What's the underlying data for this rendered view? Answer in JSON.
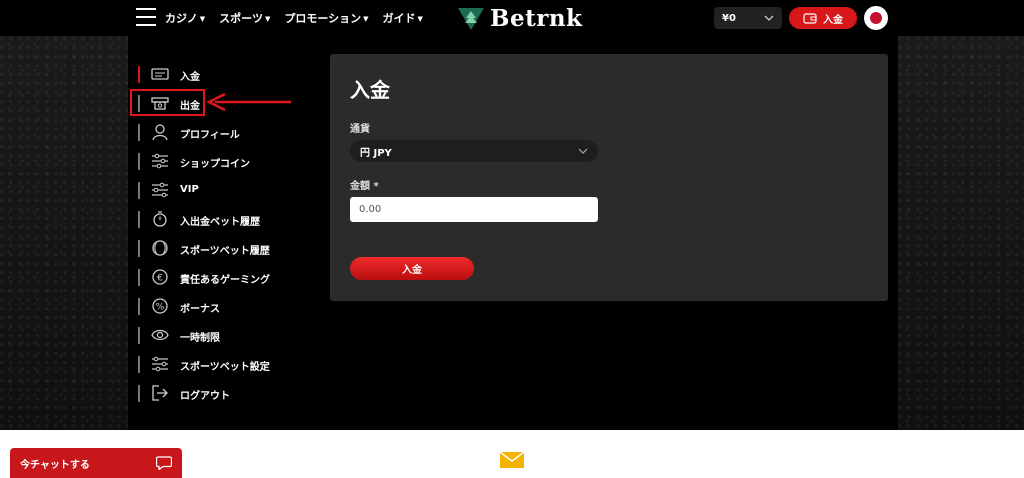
{
  "header": {
    "nav": [
      {
        "label": "カジノ"
      },
      {
        "label": "スポーツ"
      },
      {
        "label": "プロモーション"
      },
      {
        "label": "ガイド"
      }
    ],
    "logo_text": "Betrnk",
    "balance": "¥0",
    "deposit_button": "入金",
    "language_flag": "japan-flag"
  },
  "sidebar": {
    "items": [
      {
        "label": "入金",
        "icon": "atm-card-icon",
        "active": true
      },
      {
        "label": "出金",
        "icon": "cash-withdraw-icon",
        "active": false
      },
      {
        "label": "プロフィール",
        "icon": "user-icon",
        "active": false
      },
      {
        "label": "ショップコイン",
        "icon": "sliders-icon",
        "active": false
      },
      {
        "label": "VIP",
        "icon": "sliders-icon",
        "active": false
      },
      {
        "label": "入出金ベット履歴",
        "icon": "history-icon",
        "active": false
      },
      {
        "label": "スポーツベット履歴",
        "icon": "ball-icon",
        "active": false
      },
      {
        "label": "責任あるゲーミング",
        "icon": "euro-icon",
        "active": false
      },
      {
        "label": "ボーナス",
        "icon": "percent-icon",
        "active": false
      },
      {
        "label": "一時制限",
        "icon": "eye-icon",
        "active": false
      },
      {
        "label": "スポーツベット設定",
        "icon": "sliders-icon",
        "active": false
      },
      {
        "label": "ログアウト",
        "icon": "logout-icon",
        "active": false
      }
    ]
  },
  "main": {
    "title": "入金",
    "currency_label": "通貨",
    "currency_value": "円 JPY",
    "amount_label": "金額 *",
    "amount_placeholder": "0.00",
    "submit_label": "入金"
  },
  "chat": {
    "label": "今チャットする"
  },
  "colors": {
    "accent": "#d81818",
    "panel": "#2b2b2b",
    "annotation": "#e0161b"
  }
}
